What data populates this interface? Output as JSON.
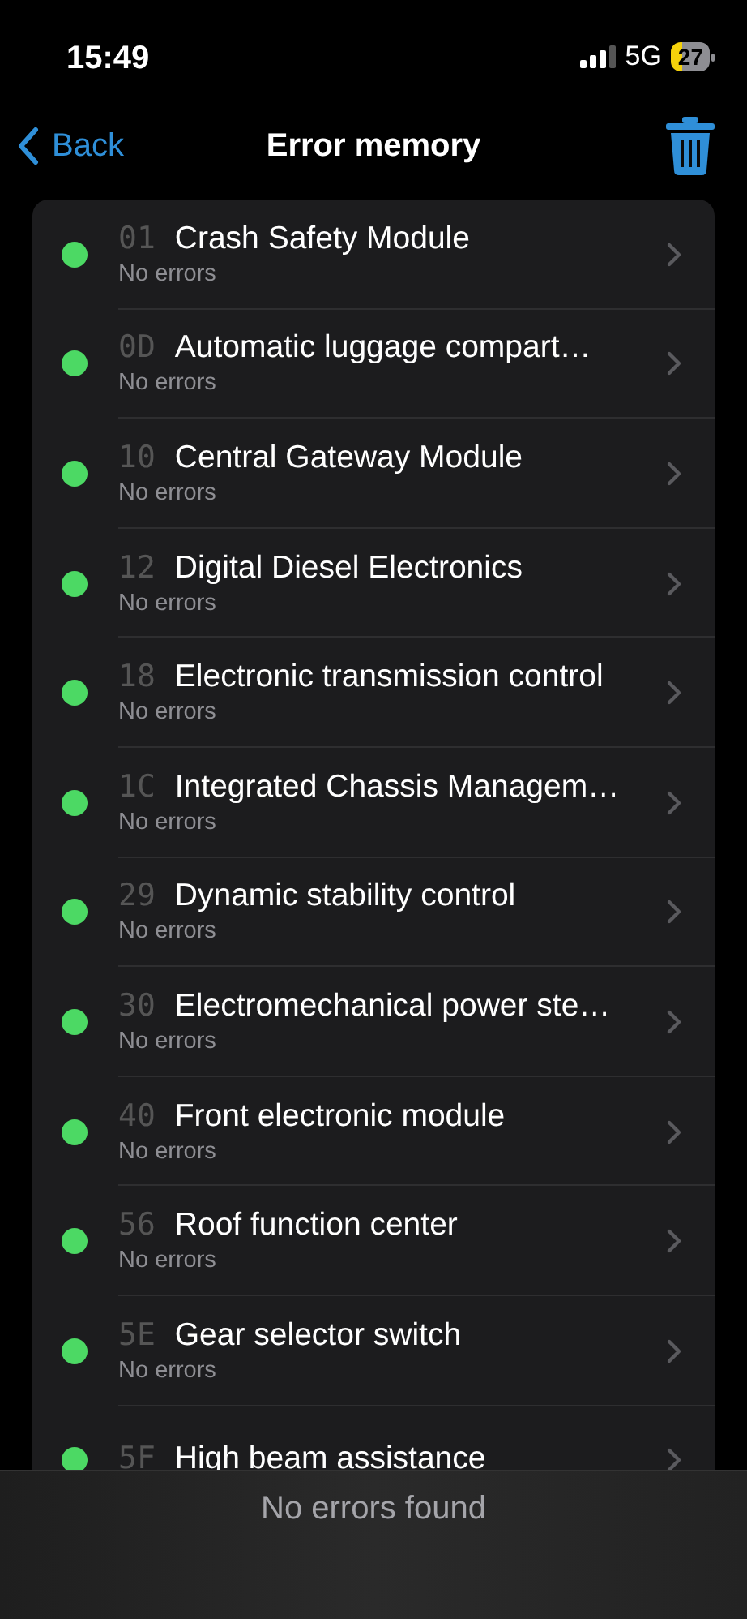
{
  "status_bar": {
    "time": "15:49",
    "network": "5G",
    "battery": "27"
  },
  "nav": {
    "back": "Back",
    "title": "Error memory"
  },
  "modules": [
    {
      "code": "01",
      "name": "Crash Safety Module",
      "status": "No errors",
      "color": "#4cd964"
    },
    {
      "code": "0D",
      "name": "Automatic luggage compart…",
      "status": "No errors",
      "color": "#4cd964"
    },
    {
      "code": "10",
      "name": "Central Gateway Module",
      "status": "No errors",
      "color": "#4cd964"
    },
    {
      "code": "12",
      "name": "Digital Diesel Electronics",
      "status": "No errors",
      "color": "#4cd964"
    },
    {
      "code": "18",
      "name": "Electronic transmission control",
      "status": "No errors",
      "color": "#4cd964"
    },
    {
      "code": "1C",
      "name": "Integrated Chassis Managem…",
      "status": "No errors",
      "color": "#4cd964"
    },
    {
      "code": "29",
      "name": "Dynamic stability control",
      "status": "No errors",
      "color": "#4cd964"
    },
    {
      "code": "30",
      "name": "Electromechanical power ste…",
      "status": "No errors",
      "color": "#4cd964"
    },
    {
      "code": "40",
      "name": "Front electronic module",
      "status": "No errors",
      "color": "#4cd964"
    },
    {
      "code": "56",
      "name": "Roof function center",
      "status": "No errors",
      "color": "#4cd964"
    },
    {
      "code": "5E",
      "name": "Gear selector switch",
      "status": "No errors",
      "color": "#4cd964"
    },
    {
      "code": "5F",
      "name": "High beam assistance",
      "color": "#4cd964"
    }
  ],
  "footer": {
    "message": "No errors found"
  }
}
